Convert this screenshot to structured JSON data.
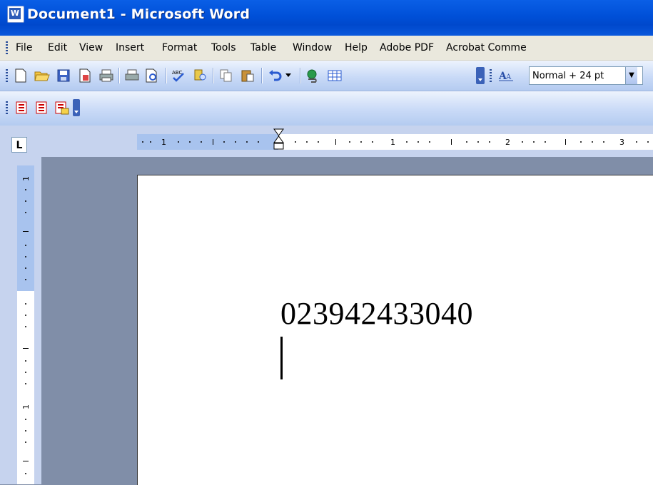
{
  "window": {
    "title": "Document1 - Microsoft Word",
    "app_icon": "word-app-icon"
  },
  "menubar": {
    "items": [
      {
        "label": "File"
      },
      {
        "label": "Edit"
      },
      {
        "label": "View"
      },
      {
        "label": "Insert"
      },
      {
        "label": "Format"
      },
      {
        "label": "Tools"
      },
      {
        "label": "Table"
      },
      {
        "label": "Window"
      },
      {
        "label": "Help"
      },
      {
        "label": "Adobe PDF"
      },
      {
        "label": "Acrobat Comme"
      }
    ]
  },
  "toolbar": {
    "buttons": [
      "new-icon",
      "open-icon",
      "save-icon",
      "permission-icon",
      "print-icon",
      "print-preview-icon",
      "spelling-icon",
      "research-icon",
      "copy-icon",
      "paste-icon",
      "undo-icon",
      "hyperlink-icon",
      "insert-table-icon"
    ],
    "style_value": "Normal + 24 pt"
  },
  "pdf_toolbar": {
    "buttons": [
      "convert-to-pdf-icon",
      "convert-and-email-icon",
      "convert-and-review-icon"
    ]
  },
  "ruler": {
    "labels": [
      "1",
      "1",
      "2",
      "3"
    ]
  },
  "vruler": {
    "labels": [
      "1",
      "1"
    ]
  },
  "document": {
    "text": "023942433040"
  }
}
